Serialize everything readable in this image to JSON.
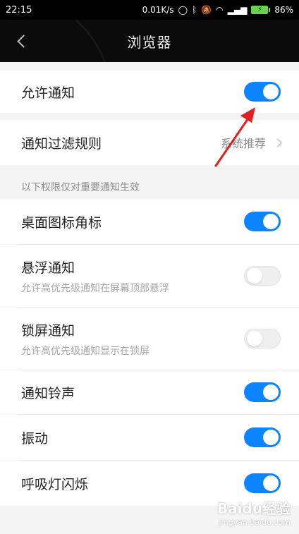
{
  "status_bar": {
    "time": "22:15",
    "net_speed": "0.01K/s",
    "battery_percent": "86%",
    "battery_color": "#6ad04f"
  },
  "header": {
    "title": "浏览器",
    "back_icon": "chevron-left-icon"
  },
  "rows": {
    "allow_notifications": {
      "label": "允许通知",
      "toggle": true
    },
    "filter_rules": {
      "label": "通知过滤规则",
      "value": "系统推荐"
    },
    "section_caption": "以下权限仅对重要通知生效",
    "desktop_badge": {
      "label": "桌面图标角标",
      "toggle": true
    },
    "floating": {
      "label": "悬浮通知",
      "sub": "允许高优先级通知在屏幕顶部悬浮",
      "toggle": false
    },
    "lockscreen": {
      "label": "锁屏通知",
      "sub": "允许高优先级通知显示在锁屏",
      "toggle": false
    },
    "ringtone": {
      "label": "通知铃声",
      "toggle": true
    },
    "vibrate": {
      "label": "振动",
      "toggle": true
    },
    "breathing_light": {
      "label": "呼吸灯闪烁",
      "toggle": true
    }
  },
  "colors": {
    "toggle_on": "#0d84ff",
    "annotation_arrow": "#e02020"
  },
  "watermark": {
    "main": "Baidu经验",
    "sub": "jingyan.baidu.com"
  }
}
